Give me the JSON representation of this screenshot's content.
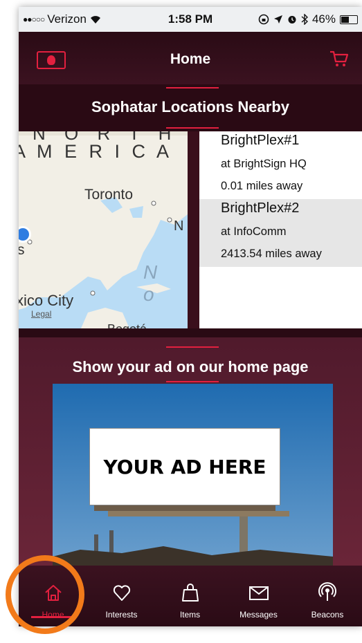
{
  "status_bar": {
    "carrier": "Verizon",
    "time": "1:58 PM",
    "battery": "46%",
    "battery_level": 0.46
  },
  "nav": {
    "title": "Home",
    "left_icon": "head-icon",
    "right_icon": "cart-icon"
  },
  "locations_section": {
    "title": "Sophatar Locations Nearby",
    "map_labels": {
      "continent_line1": "N O R T H",
      "continent_line2": "A M E R I C A",
      "toronto": "Toronto",
      "n_letter": "N",
      "no_partial": "N o",
      "city_partial": "xico City",
      "s_partial": "s",
      "bogota_partial": "Bogotá",
      "legal": "Legal"
    },
    "items": [
      {
        "name": "BrightPlex#1",
        "venue": "at BrightSign HQ",
        "distance": "0.01 miles away"
      },
      {
        "name": "BrightPlex#2",
        "venue": "at InfoComm",
        "distance": "2413.54 miles away"
      }
    ]
  },
  "ad_section": {
    "title": "Show your ad on our home page",
    "ad_text": "YOUR AD HERE"
  },
  "tabs": [
    {
      "label": "Home",
      "icon": "home-icon",
      "active": true
    },
    {
      "label": "Interests",
      "icon": "heart-icon",
      "active": false
    },
    {
      "label": "Items",
      "icon": "bag-icon",
      "active": false
    },
    {
      "label": "Messages",
      "icon": "envelope-icon",
      "active": false
    },
    {
      "label": "Beacons",
      "icon": "beacon-icon",
      "active": false
    }
  ],
  "colors": {
    "accent": "#e3203f",
    "background": "#3a0f1c",
    "highlight": "#f27a1a"
  }
}
